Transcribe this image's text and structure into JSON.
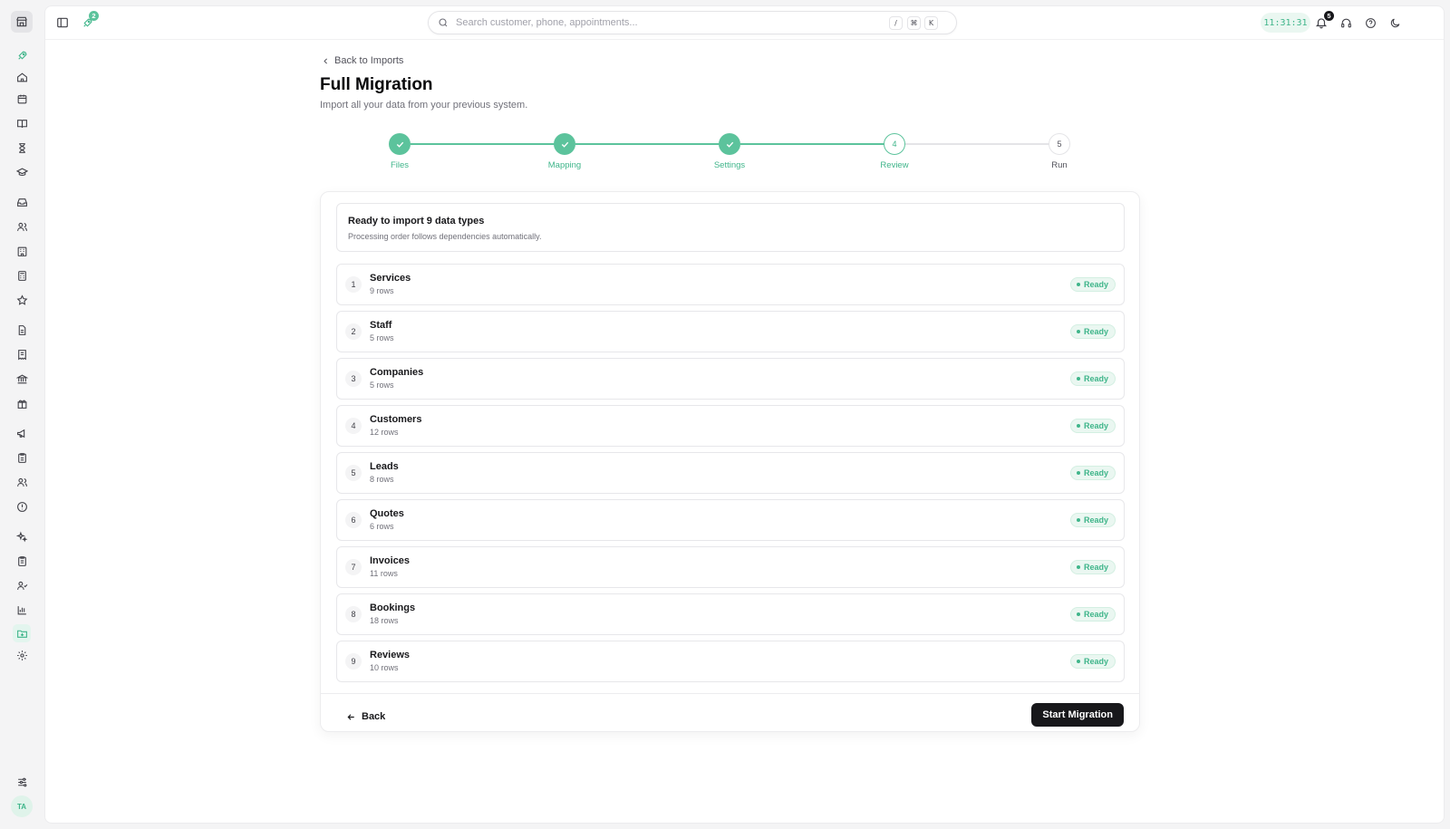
{
  "topbar": {
    "rocket_badge": "2",
    "search_placeholder": "Search customer, phone, appointments...",
    "shortcut_keys": [
      "/",
      "⌘",
      "K"
    ],
    "clock": "11:31:31",
    "notifications_badge": "5"
  },
  "sidebar": {
    "avatar_initials": "TA"
  },
  "page": {
    "back_label": "Back to Imports",
    "title": "Full Migration",
    "subtitle": "Import all your data from your previous system."
  },
  "steps": [
    {
      "label": "Files",
      "state": "done",
      "number": "1"
    },
    {
      "label": "Mapping",
      "state": "done",
      "number": "2"
    },
    {
      "label": "Settings",
      "state": "done",
      "number": "3"
    },
    {
      "label": "Review",
      "state": "current",
      "number": "4"
    },
    {
      "label": "Run",
      "state": "todo",
      "number": "5"
    }
  ],
  "summary": {
    "title": "Ready to import 9 data types",
    "description": "Processing order follows dependencies automatically."
  },
  "data_types": [
    {
      "index": "1",
      "name": "Services",
      "rows": "9 rows",
      "status": "Ready"
    },
    {
      "index": "2",
      "name": "Staff",
      "rows": "5 rows",
      "status": "Ready"
    },
    {
      "index": "3",
      "name": "Companies",
      "rows": "5 rows",
      "status": "Ready"
    },
    {
      "index": "4",
      "name": "Customers",
      "rows": "12 rows",
      "status": "Ready"
    },
    {
      "index": "5",
      "name": "Leads",
      "rows": "8 rows",
      "status": "Ready"
    },
    {
      "index": "6",
      "name": "Quotes",
      "rows": "6 rows",
      "status": "Ready"
    },
    {
      "index": "7",
      "name": "Invoices",
      "rows": "11 rows",
      "status": "Ready"
    },
    {
      "index": "8",
      "name": "Bookings",
      "rows": "18 rows",
      "status": "Ready"
    },
    {
      "index": "9",
      "name": "Reviews",
      "rows": "10 rows",
      "status": "Ready"
    }
  ],
  "footer": {
    "back_label": "Back",
    "start_label": "Start Migration"
  },
  "colors": {
    "accent": "#3fb58a",
    "step_done": "#5cc39c",
    "primary_button": "#18181b"
  }
}
